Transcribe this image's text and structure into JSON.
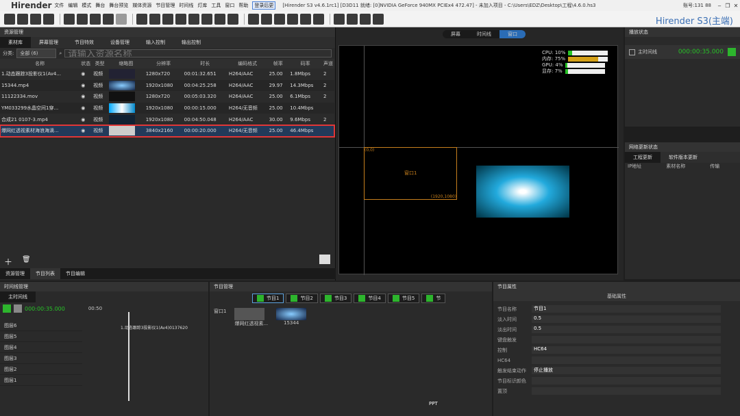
{
  "menubar": {
    "logo": "Hirender",
    "items": [
      "文件",
      "编辑",
      "模式",
      "舞台",
      "舞台预览",
      "媒体资源",
      "节目管理",
      "时间线",
      "灯库",
      "工具",
      "窗口",
      "帮助"
    ],
    "highlight": "登录后更",
    "title": "[Hirender S3 v4.6.1rc1]  [D3D11 就绪: [0]NVIDIA GeForce 940MX PCIEx4 472.47]  - 未加入项目 - C:\\Users\\EDZ\\Desktop\\工程\\4.6.0.hs3",
    "account": "账号:131           88",
    "brand": "Hirender S3(主端)"
  },
  "resource": {
    "title": "资源管理",
    "tabs": [
      "素材库",
      "屏幕管理",
      "节目特效",
      "设备管理",
      "输入控制",
      "输出控制"
    ],
    "filter_label": "分类:",
    "filter_value": "全部 (6)",
    "search_placeholder": "请输入资源名称",
    "columns": [
      "名称",
      "状态",
      "类型",
      "缩略图",
      "分辨率",
      "时长",
      "编码格式",
      "帧率",
      "码率",
      "声道"
    ],
    "rows": [
      {
        "name": "1.动态跟踪3投影仪1(Av4...",
        "type": "视频",
        "res": "1280x720",
        "dur": "00:01:32.651",
        "codec": "H264/AAC",
        "fps": "25.00",
        "rate": "1.8Mbps",
        "ch": "2"
      },
      {
        "name": "15344.mp4",
        "type": "视频",
        "res": "1920x1080",
        "dur": "00:04:25.258",
        "codec": "H264/AAC",
        "fps": "29.97",
        "rate": "14.3Mbps",
        "ch": "2"
      },
      {
        "name": "11122334.mov",
        "type": "视频",
        "res": "1280x720",
        "dur": "00:05:03.320",
        "codec": "H264/AAC",
        "fps": "25.00",
        "rate": "6.1Mbps",
        "ch": "2"
      },
      {
        "name": "YM033299水晶空间1穿...",
        "type": "视频",
        "res": "1920x1080",
        "dur": "00:00:15.000",
        "codec": "H264/无音频",
        "fps": "25.00",
        "rate": "10.4Mbps",
        "ch": ""
      },
      {
        "name": "合成21 0107-3.mp4",
        "type": "视频",
        "res": "1920x1080",
        "dur": "00:04:50.048",
        "codec": "H264/AAC",
        "fps": "30.00",
        "rate": "9.6Mbps",
        "ch": "2"
      },
      {
        "name": "爆网红透视素材海浪海滴...",
        "type": "视频",
        "res": "3840x2160",
        "dur": "00:00:20.000",
        "codec": "H264/无音频",
        "fps": "25.00",
        "rate": "46.4Mbps",
        "ch": ""
      }
    ],
    "bottom_tabs": [
      "资源管理",
      "节目列表",
      "节目编辑"
    ]
  },
  "preview": {
    "modes": [
      "屏幕",
      "时间线",
      "窗口"
    ],
    "window_label": "窗口1",
    "coord_tl": "(0,0)",
    "coord_br": "(1920,1080)",
    "stats": [
      {
        "k": "CPU:",
        "v": "10%",
        "p": 0.1
      },
      {
        "k": "内存:",
        "v": "75%",
        "p": 0.75
      },
      {
        "k": "GPU:",
        "v": "4%",
        "p": 0.04
      },
      {
        "k": "显存:",
        "v": "7%",
        "p": 0.07
      }
    ]
  },
  "play": {
    "title": "播放状态",
    "timeline": "主时间线",
    "time": "000:00:35.000"
  },
  "net": {
    "title": "网络更新状态",
    "tabs": [
      "工程更新",
      "软件版本更新"
    ],
    "cols": [
      "IP地址",
      "素材名称",
      "传输"
    ]
  },
  "timeline": {
    "title": "时间线管理",
    "tab": "主时间线",
    "time": "000:00:35.000",
    "marker": "00:50",
    "clip": "1.动态跟踪3投影仪1(Av4)0137620",
    "layers": [
      "图层6",
      "图层5",
      "图层4",
      "图层3",
      "图层2",
      "图层1"
    ]
  },
  "program": {
    "title": "节目管理",
    "chips": [
      "节目1",
      "节目2",
      "节目3",
      "节目4",
      "节目5",
      "节"
    ],
    "window": "窗口1",
    "items": [
      "爆网红透视素...",
      "15344"
    ],
    "ppt": "PPT"
  },
  "attrs": {
    "title": "节目属性",
    "section": "基础属性",
    "fields": [
      {
        "k": "节目名称",
        "v": "节目1"
      },
      {
        "k": "淡入时间",
        "v": "0.5"
      },
      {
        "k": "淡出时间",
        "v": "0.5"
      },
      {
        "k": "键盘触发",
        "v": ""
      },
      {
        "k": "控制",
        "v": "HC64"
      },
      {
        "k": "HC64",
        "v": ""
      },
      {
        "k": "触发结束动作",
        "v": "停止播放"
      },
      {
        "k": "节目标识颜色",
        "v": ""
      },
      {
        "k": "置顶",
        "v": ""
      }
    ]
  }
}
